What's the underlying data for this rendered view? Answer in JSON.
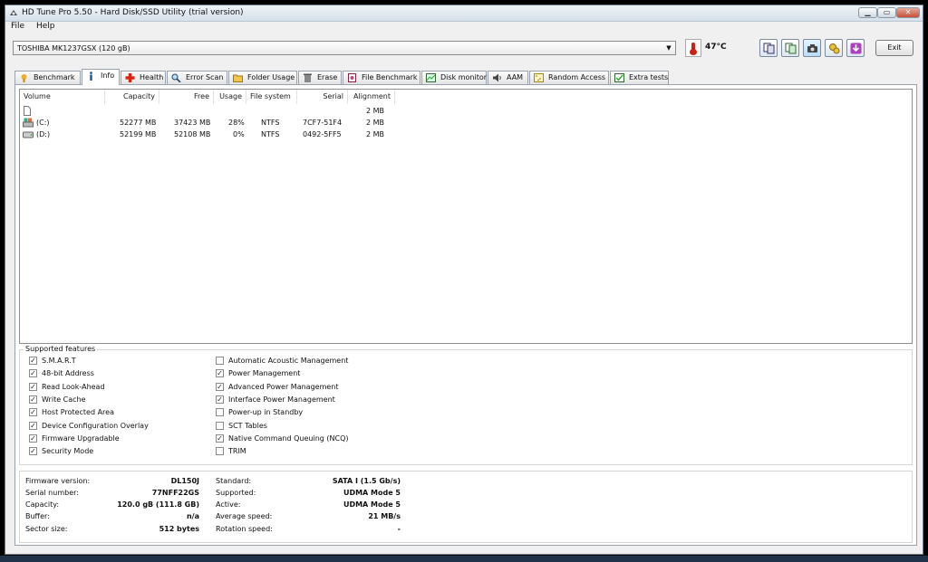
{
  "window": {
    "title": "HD Tune Pro 5.50 - Hard Disk/SSD Utility (trial version)",
    "min_label": "▁",
    "max_label": "▭",
    "close_label": "✕"
  },
  "menu": [
    "File",
    "Help"
  ],
  "toolbar": {
    "drive": "TOSHIBA MK1237GSX (120 gB)",
    "temperature": "47°C",
    "exit_label": "Exit",
    "buttons": [
      "copy-icon",
      "copy-text-icon",
      "screenshot-icon",
      "options-icon",
      "save-icon"
    ]
  },
  "tabs": [
    {
      "label": "Benchmark",
      "icon": "benchmark-icon"
    },
    {
      "label": "Info",
      "icon": "info-icon"
    },
    {
      "label": "Health",
      "icon": "health-icon"
    },
    {
      "label": "Error Scan",
      "icon": "error-scan-icon"
    },
    {
      "label": "Folder Usage",
      "icon": "folder-icon"
    },
    {
      "label": "Erase",
      "icon": "erase-icon"
    },
    {
      "label": "File Benchmark",
      "icon": "file-benchmark-icon"
    },
    {
      "label": "Disk monitor",
      "icon": "disk-monitor-icon"
    },
    {
      "label": "AAM",
      "icon": "aam-icon"
    },
    {
      "label": "Random Access",
      "icon": "random-access-icon"
    },
    {
      "label": "Extra tests",
      "icon": "extra-tests-icon"
    }
  ],
  "volumes": {
    "columns": [
      "Volume",
      "Capacity",
      "Free",
      "Usage",
      "File system",
      "Serial",
      "Alignment"
    ],
    "rows": [
      {
        "volume": "",
        "capacity": "",
        "free": "",
        "usage": "",
        "fs": "",
        "serial": "",
        "alignment": "2 MB"
      },
      {
        "volume": "(C:)",
        "capacity": "52277 MB",
        "free": "37423 MB",
        "usage": "28%",
        "fs": "NTFS",
        "serial": "7CF7-51F4",
        "alignment": "2 MB"
      },
      {
        "volume": "(D:)",
        "capacity": "52199 MB",
        "free": "52108 MB",
        "usage": "0%",
        "fs": "NTFS",
        "serial": "0492-5FF5",
        "alignment": "2 MB"
      }
    ]
  },
  "features": {
    "legend": "Supported features",
    "left": [
      {
        "label": "S.M.A.R.T",
        "checked": true
      },
      {
        "label": "48-bit Address",
        "checked": true
      },
      {
        "label": "Read Look-Ahead",
        "checked": true
      },
      {
        "label": "Write Cache",
        "checked": true
      },
      {
        "label": "Host Protected Area",
        "checked": true
      },
      {
        "label": "Device Configuration Overlay",
        "checked": true
      },
      {
        "label": "Firmware Upgradable",
        "checked": true
      },
      {
        "label": "Security Mode",
        "checked": true
      }
    ],
    "right": [
      {
        "label": "Automatic Acoustic Management",
        "checked": false
      },
      {
        "label": "Power Management",
        "checked": true
      },
      {
        "label": "Advanced Power Management",
        "checked": true
      },
      {
        "label": "Interface Power Management",
        "checked": true
      },
      {
        "label": "Power-up in Standby",
        "checked": false
      },
      {
        "label": "SCT Tables",
        "checked": false
      },
      {
        "label": "Native Command Queuing (NCQ)",
        "checked": true
      },
      {
        "label": "TRIM",
        "checked": false
      }
    ]
  },
  "info": {
    "left": [
      {
        "label": "Firmware version:",
        "value": "DL150J"
      },
      {
        "label": "Serial number:",
        "value": "77NFF22GS"
      },
      {
        "label": "Capacity:",
        "value": "120.0 gB (111.8 GB)"
      },
      {
        "label": "Buffer:",
        "value": "n/a"
      },
      {
        "label": "Sector size:",
        "value": "512 bytes"
      }
    ],
    "right": [
      {
        "label": "Standard:",
        "value": "SATA I (1.5 Gb/s)"
      },
      {
        "label": "Supported:",
        "value": "UDMA Mode 5"
      },
      {
        "label": "Active:",
        "value": "UDMA Mode 5"
      },
      {
        "label": "Average speed:",
        "value": "21 MB/s"
      },
      {
        "label": "Rotation speed:",
        "value": "-"
      }
    ]
  },
  "colors": {
    "titlebar": "#dfe7f0",
    "close": "#c5503a",
    "thermometer": "#cc2211"
  }
}
